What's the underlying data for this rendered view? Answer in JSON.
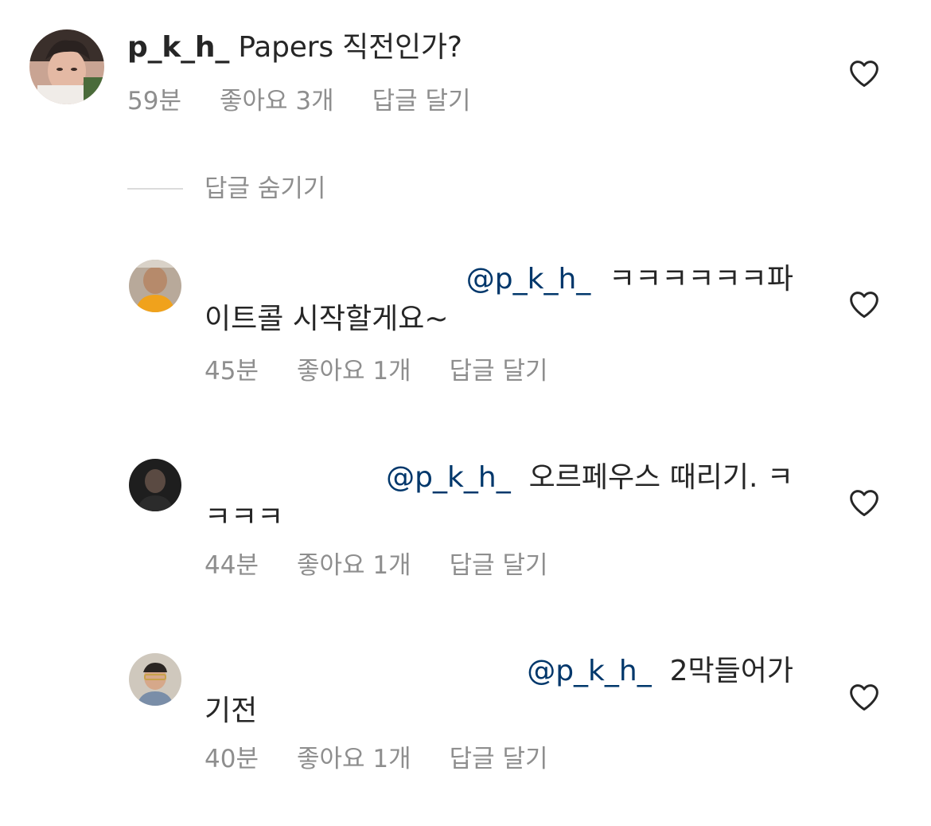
{
  "comment": {
    "username": "p_k_h_",
    "text": "Papers 직전인가?",
    "time": "59분",
    "likes": "좋아요 3개",
    "reply_label": "답글 달기"
  },
  "hide_replies_label": "답글 숨기기",
  "replies": [
    {
      "mention": "@p_k_h_",
      "text_line1": "ㅋㅋㅋㅋㅋㅋ파",
      "text_line2": "이트콜 시작할게요~",
      "time": "45분",
      "likes": "좋아요 1개",
      "reply_label": "답글 달기"
    },
    {
      "mention": "@p_k_h_",
      "text_line1": "오르페우스 때리기. ㅋ",
      "text_line2": "ㅋㅋㅋ",
      "time": "44분",
      "likes": "좋아요 1개",
      "reply_label": "답글 달기"
    },
    {
      "mention": "@p_k_h_",
      "text_line1": "2막들어가",
      "text_line2": "기전",
      "time": "40분",
      "likes": "좋아요 1개",
      "reply_label": "답글 달기"
    }
  ],
  "colors": {
    "text": "#262626",
    "meta": "#8e8e8e",
    "mention": "#00376b",
    "divider": "#dbdbdb"
  },
  "icons": {
    "like": "heart-outline-icon"
  }
}
